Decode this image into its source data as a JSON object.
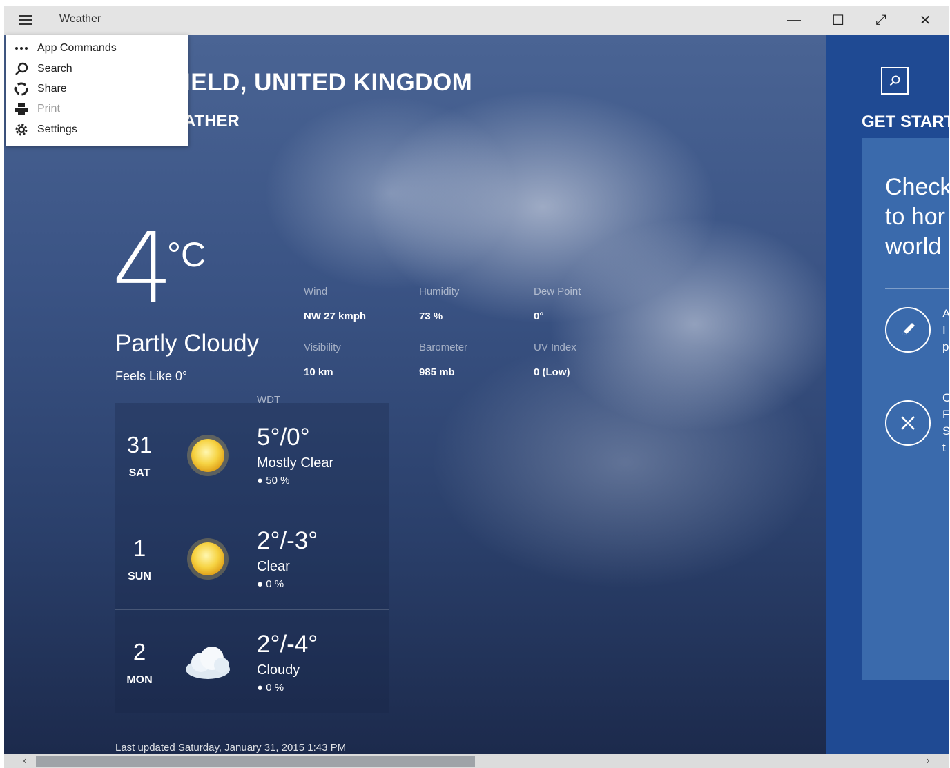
{
  "window": {
    "title": "Weather",
    "controls": {
      "minimize": "—",
      "maximize": "☐",
      "fullscreen": "⤢",
      "close": "✕"
    }
  },
  "menu": {
    "items": [
      {
        "label": "App Commands",
        "icon": "ellipsis-icon",
        "disabled": false
      },
      {
        "label": "Search",
        "icon": "search-icon",
        "disabled": false
      },
      {
        "label": "Share",
        "icon": "share-icon",
        "disabled": false
      },
      {
        "label": "Print",
        "icon": "print-icon",
        "disabled": true
      },
      {
        "label": "Settings",
        "icon": "gear-icon",
        "disabled": false
      }
    ]
  },
  "main": {
    "location": "IELD, UNITED KINGDOM",
    "subtitle": "ATHER",
    "temperature": "4",
    "unit": "°C",
    "condition": "Partly Cloudy",
    "feels_like": "Feels Like 0°",
    "stats": [
      {
        "label": "Wind",
        "value": "NW 27 kmph"
      },
      {
        "label": "Humidity",
        "value": "73 %"
      },
      {
        "label": "Dew Point",
        "value": "0°"
      },
      {
        "label": "Visibility",
        "value": "10 km"
      },
      {
        "label": "Barometer",
        "value": "985 mb"
      },
      {
        "label": "UV Index",
        "value": "0 (Low)"
      }
    ],
    "wdt_label": "WDT",
    "forecast": [
      {
        "day": "31",
        "weekday": "SAT",
        "icon": "sun-icon",
        "temps": "5°/0°",
        "condition": "Mostly Clear",
        "precip": "50 %"
      },
      {
        "day": "1",
        "weekday": "SUN",
        "icon": "sun-icon",
        "temps": "2°/-3°",
        "condition": "Clear",
        "precip": "0 %"
      },
      {
        "day": "2",
        "weekday": "MON",
        "icon": "cloud-icon",
        "temps": "2°/-4°",
        "condition": "Cloudy",
        "precip": "0 %"
      }
    ],
    "precip_icon": "raindrop-icon",
    "last_updated": "Last updated Saturday, January 31, 2015 1:43 PM"
  },
  "right_panel": {
    "heading": "GET START",
    "card_text": "Check\nto hor\nworld",
    "actions": [
      {
        "icon": "pencil-icon",
        "letters": "A\nI\np"
      },
      {
        "icon": "close-circle-icon",
        "letters": "C\nF\nS\nt"
      }
    ]
  },
  "scrollbar": {
    "left_arrow": "‹",
    "right_arrow": "›"
  },
  "colors": {
    "titlebar": "#e4e4e4",
    "panel": "#1f4a93",
    "card": "#3a6aac",
    "sun": "#f6d343"
  }
}
